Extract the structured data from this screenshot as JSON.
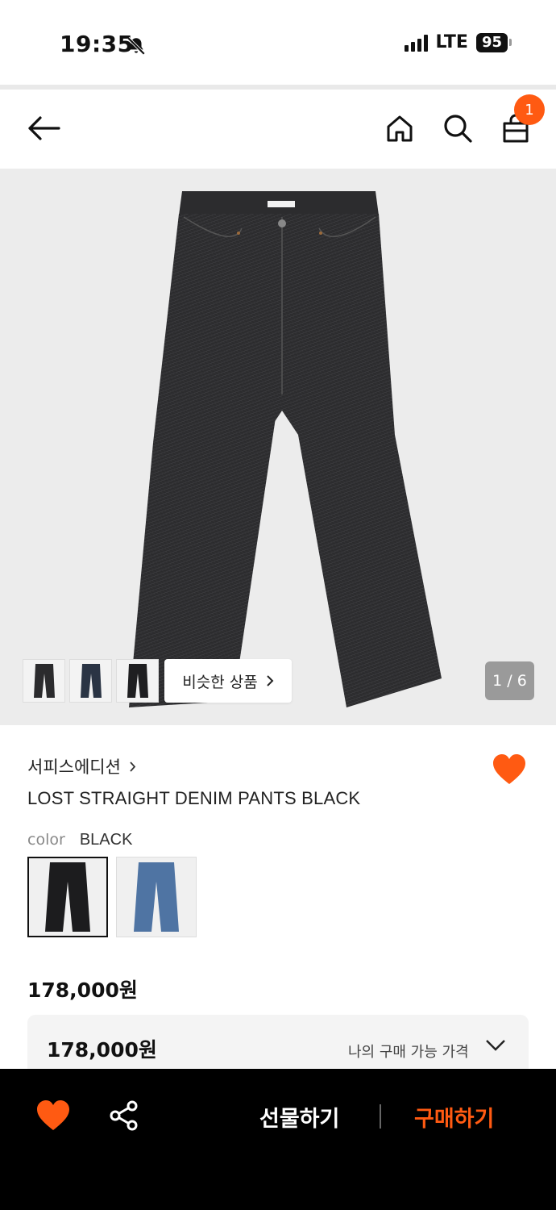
{
  "status_bar": {
    "time": "19:35",
    "network": "LTE",
    "battery": "95",
    "signal_bars": 4
  },
  "header": {
    "cart_count": "1",
    "icons": [
      "back-arrow-icon",
      "home-icon",
      "search-icon",
      "shopping-bag-icon"
    ]
  },
  "gallery": {
    "similar_label": "비슷한 상품",
    "page_counter": "1 / 6",
    "current_page": 1,
    "total_pages": 6
  },
  "product": {
    "brand": "서피스에디션",
    "title": "LOST STRAIGHT DENIM PANTS BLACK",
    "color_label": "color",
    "color_value": "BLACK",
    "price": "178,000원",
    "my_price": "178,000원",
    "my_price_label": "나의 구매 가능 가격"
  },
  "bottom_bar": {
    "gift_label": "선물하기",
    "buy_label": "구매하기"
  },
  "colors": {
    "accent": "#ff5a12",
    "hero_bg": "#ececec",
    "bottom_bar_bg": "#000000"
  }
}
